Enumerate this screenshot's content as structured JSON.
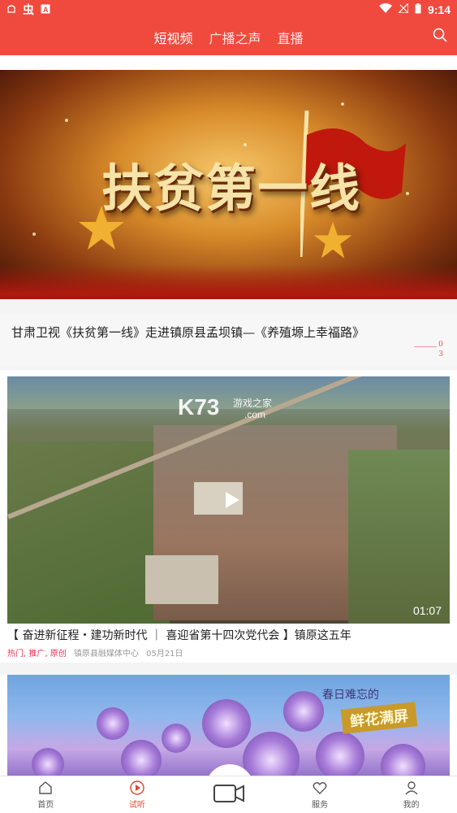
{
  "status_bar": {
    "time": "9:14",
    "left_icons": [
      "notification-icon",
      "app-icon",
      "a-icon"
    ],
    "right_icons": [
      "wifi-icon",
      "no-signal-icon",
      "battery-icon"
    ]
  },
  "header": {
    "tabs": [
      {
        "label": "短视频",
        "active": true
      },
      {
        "label": "广播之声",
        "active": false
      },
      {
        "label": "直播",
        "active": false
      }
    ],
    "accent_color": "#f04a3e"
  },
  "banner": {
    "title_text": "扶贫第一线"
  },
  "article": {
    "title": "甘肃卫视《扶贫第一线》走进镇原县孟坝镇—《养殖塬上幸福路》",
    "counter_top": "0",
    "counter_bottom": "3"
  },
  "video1": {
    "watermark_main": "K73",
    "watermark_sub": "游戏之家",
    "watermark_domain": ".com",
    "duration": "01:07",
    "title": "【 奋进新征程・建功新时代 ｜ 喜迎省第十四次党代会 】镇原这五年",
    "tags": "热门, 推广, 原创",
    "source": "镇原县融媒体中心",
    "date": "05月21日"
  },
  "video2": {
    "line1": "春日难忘的",
    "line2": "鲜花满屏"
  },
  "bottom_nav": [
    {
      "label": "首页",
      "icon": "home-icon",
      "active": false
    },
    {
      "label": "试听",
      "icon": "play-circle-icon",
      "active": true
    },
    {
      "label": "",
      "icon": "video-camera-icon",
      "active": false
    },
    {
      "label": "服务",
      "icon": "heart-icon",
      "active": false
    },
    {
      "label": "我的",
      "icon": "user-icon",
      "active": false
    }
  ]
}
